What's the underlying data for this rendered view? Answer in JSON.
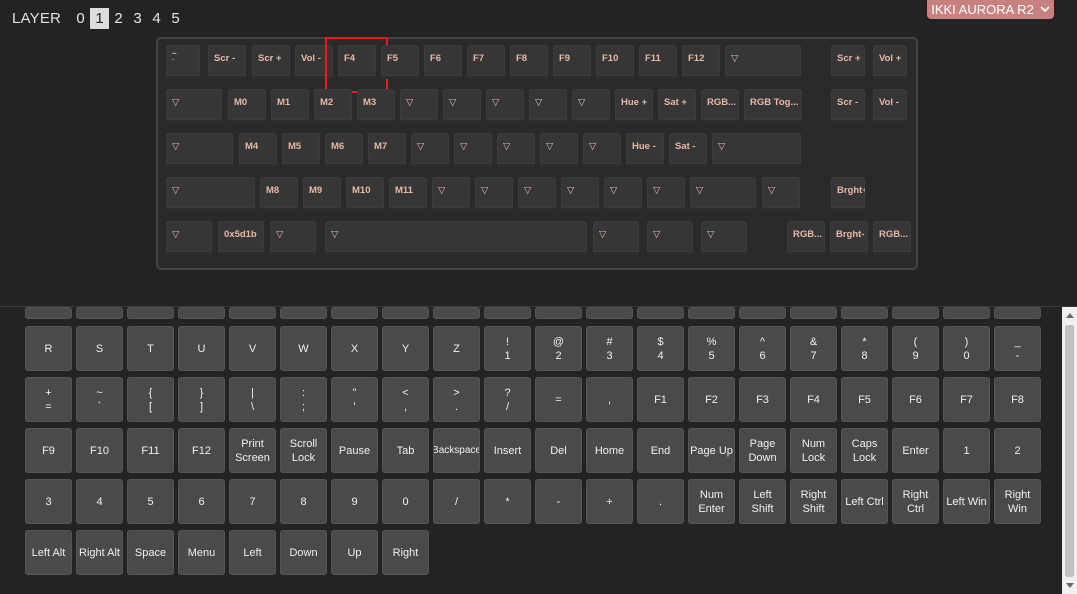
{
  "layer": {
    "label": "LAYER",
    "numbers": [
      "0",
      "1",
      "2",
      "3",
      "4",
      "5"
    ],
    "active": "1"
  },
  "device": {
    "name": "IKKI AURORA R2"
  },
  "keyboard_rows": [
    [
      "~\n`",
      "Scr -",
      "Scr +",
      "Vol -",
      "F4",
      "F5",
      "F6",
      "F7",
      "F8",
      "F9",
      "F10",
      "F11",
      "F12",
      "▽",
      "Scr +",
      "Vol +"
    ],
    [
      "▽",
      "M0",
      "M1",
      "M2",
      "M3",
      "▽",
      "▽",
      "▽",
      "▽",
      "▽",
      "Hue +",
      "Sat +",
      "RGB...",
      "RGB Tog...",
      "Scr -",
      "Vol -"
    ],
    [
      "▽",
      "M4",
      "M5",
      "M6",
      "M7",
      "▽",
      "▽",
      "▽",
      "▽",
      "▽",
      "Hue -",
      "Sat -",
      "▽"
    ],
    [
      "▽",
      "M8",
      "M9",
      "M10",
      "M11",
      "▽",
      "▽",
      "▽",
      "▽",
      "▽",
      "▽",
      "▽",
      "▽",
      "Brght+"
    ],
    [
      "▽",
      "0x5d1b",
      "▽",
      "▽",
      "▽",
      "▽",
      "▽",
      "RGB...",
      "Brght-",
      "RGB..."
    ]
  ],
  "selected_key": "F4",
  "picker_rows": [
    [
      [
        "R"
      ],
      [
        "S"
      ],
      [
        "T"
      ],
      [
        "U"
      ],
      [
        "V"
      ],
      [
        "W"
      ],
      [
        "X"
      ],
      [
        "Y"
      ],
      [
        "Z"
      ],
      [
        "!",
        "1"
      ],
      [
        "@",
        "2"
      ],
      [
        "#",
        "3"
      ],
      [
        "$",
        "4"
      ],
      [
        "%",
        "5"
      ],
      [
        "^",
        "6"
      ],
      [
        "&",
        "7"
      ],
      [
        "*",
        "8"
      ],
      [
        "(",
        "9"
      ],
      [
        ")",
        "0"
      ],
      [
        "_",
        "-"
      ]
    ],
    [
      [
        "+",
        "="
      ],
      [
        "~",
        "`"
      ],
      [
        "{",
        "["
      ],
      [
        "}",
        "]"
      ],
      [
        "|",
        "\\"
      ],
      [
        ":",
        ";"
      ],
      [
        "\"",
        "'"
      ],
      [
        "<",
        ","
      ],
      [
        ">",
        "."
      ],
      [
        "?",
        "/"
      ],
      [
        "="
      ],
      [
        ","
      ],
      [
        "F1"
      ],
      [
        "F2"
      ],
      [
        "F3"
      ],
      [
        "F4"
      ],
      [
        "F5"
      ],
      [
        "F6"
      ],
      [
        "F7"
      ],
      [
        "F8"
      ]
    ],
    [
      [
        "F9"
      ],
      [
        "F10"
      ],
      [
        "F11"
      ],
      [
        "F12"
      ],
      [
        "Print",
        "Screen"
      ],
      [
        "Scroll",
        "Lock"
      ],
      [
        "Pause"
      ],
      [
        "Tab"
      ],
      [
        "Backspace"
      ],
      [
        "Insert"
      ],
      [
        "Del"
      ],
      [
        "Home"
      ],
      [
        "End"
      ],
      [
        "Page Up"
      ],
      [
        "Page",
        "Down"
      ],
      [
        "Num",
        "Lock"
      ],
      [
        "Caps",
        "Lock"
      ],
      [
        "Enter"
      ],
      [
        "1"
      ],
      [
        "2"
      ]
    ],
    [
      [
        "3"
      ],
      [
        "4"
      ],
      [
        "5"
      ],
      [
        "6"
      ],
      [
        "7"
      ],
      [
        "8"
      ],
      [
        "9"
      ],
      [
        "0"
      ],
      [
        "/"
      ],
      [
        "*"
      ],
      [
        "-"
      ],
      [
        "+"
      ],
      [
        "."
      ],
      [
        "Num",
        "Enter"
      ],
      [
        "Left",
        "Shift"
      ],
      [
        "Right",
        "Shift"
      ],
      [
        "Left Ctrl"
      ],
      [
        "Right",
        "Ctrl"
      ],
      [
        "Left Win"
      ],
      [
        "Right",
        "Win"
      ]
    ],
    [
      [
        "Left Alt"
      ],
      [
        "Right Alt"
      ],
      [
        "Space"
      ],
      [
        "Menu"
      ],
      [
        "Left"
      ],
      [
        "Down"
      ],
      [
        "Up"
      ],
      [
        "Right"
      ]
    ]
  ]
}
